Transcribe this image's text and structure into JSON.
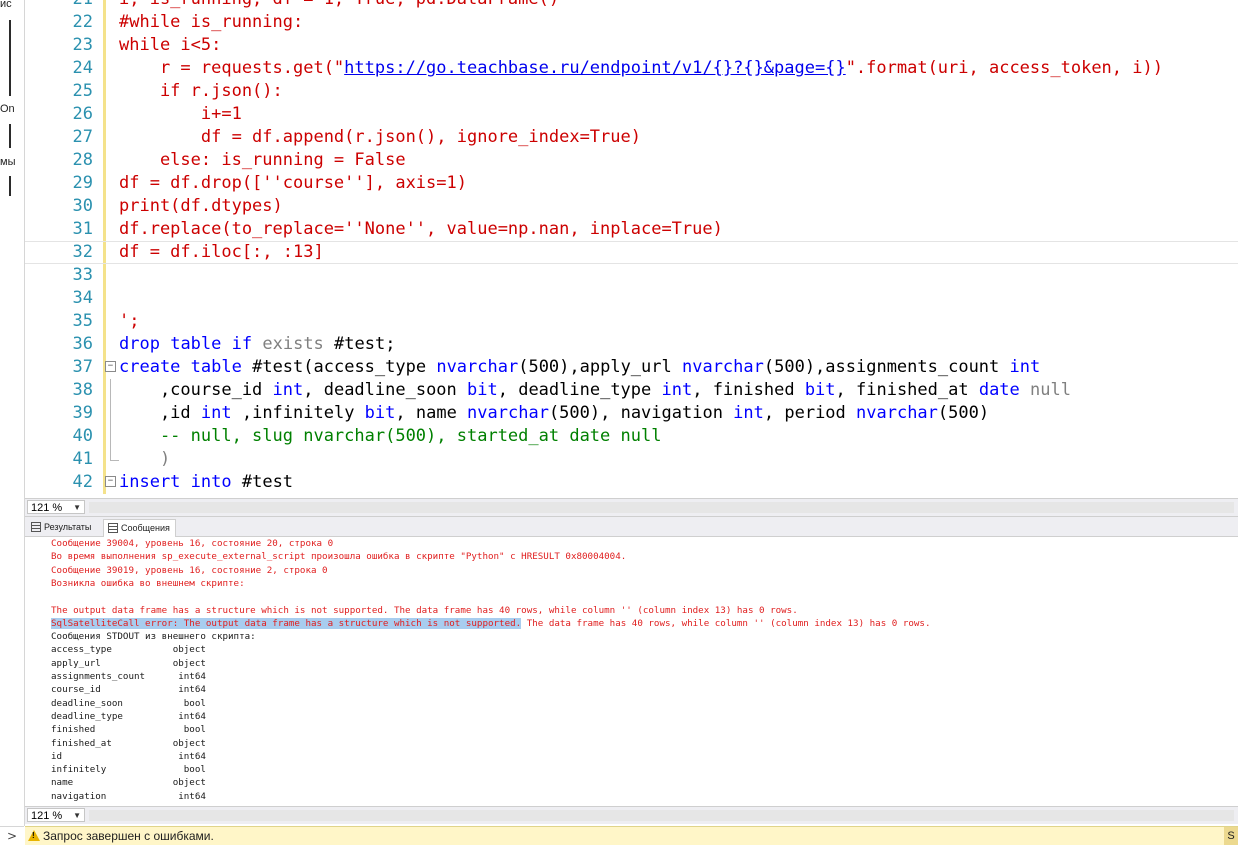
{
  "left_panel": {
    "fragments": [
      "ис",
      "On",
      "мы"
    ]
  },
  "editor": {
    "lines": [
      {
        "num": "21",
        "segments": [
          {
            "t": "i, is_running, df = 1, True, pd.DataFrame()",
            "c": "str"
          }
        ]
      },
      {
        "num": "22",
        "segments": [
          {
            "t": "#while is_running:",
            "c": "str"
          }
        ]
      },
      {
        "num": "23",
        "segments": [
          {
            "t": "while i<5:",
            "c": "str"
          }
        ]
      },
      {
        "num": "24",
        "segments": [
          {
            "t": "    r = requests.get(\"",
            "c": "str"
          },
          {
            "t": "https://go.teachbase.ru/endpoint/v1/{}?{}&page={}",
            "c": "link"
          },
          {
            "t": "\".format(uri, access_token, i))",
            "c": "str"
          }
        ]
      },
      {
        "num": "25",
        "segments": [
          {
            "t": "    if r.json():",
            "c": "str"
          }
        ]
      },
      {
        "num": "26",
        "segments": [
          {
            "t": "        i+=1",
            "c": "str"
          }
        ]
      },
      {
        "num": "27",
        "segments": [
          {
            "t": "        df = df.append(r.json(), ignore_index=True)",
            "c": "str"
          }
        ]
      },
      {
        "num": "28",
        "segments": [
          {
            "t": "    else: is_running = False",
            "c": "str"
          }
        ]
      },
      {
        "num": "29",
        "segments": [
          {
            "t": "df = df.drop([''course''], axis=1)",
            "c": "str"
          }
        ]
      },
      {
        "num": "30",
        "segments": [
          {
            "t": "print(df.dtypes)",
            "c": "str"
          }
        ]
      },
      {
        "num": "31",
        "segments": [
          {
            "t": "df.replace(to_replace=''None'', value=np.nan, inplace=True)",
            "c": "str"
          }
        ]
      },
      {
        "num": "32",
        "segments": [
          {
            "t": "df = df.iloc[:, :13]",
            "c": "str"
          }
        ],
        "current": true
      },
      {
        "num": "33",
        "segments": []
      },
      {
        "num": "34",
        "segments": []
      },
      {
        "num": "35",
        "segments": [
          {
            "t": "';",
            "c": "str"
          }
        ]
      },
      {
        "num": "36",
        "segments": [
          {
            "t": "drop",
            "c": "kw"
          },
          {
            "t": " ",
            "c": "def"
          },
          {
            "t": "table",
            "c": "kw"
          },
          {
            "t": " ",
            "c": "def"
          },
          {
            "t": "if",
            "c": "kw"
          },
          {
            "t": " ",
            "c": "def"
          },
          {
            "t": "exists",
            "c": "gray"
          },
          {
            "t": " #test;",
            "c": "def"
          }
        ]
      },
      {
        "num": "37",
        "segments": [
          {
            "t": "create",
            "c": "kw"
          },
          {
            "t": " ",
            "c": "def"
          },
          {
            "t": "table",
            "c": "kw"
          },
          {
            "t": " #test(access_type ",
            "c": "def"
          },
          {
            "t": "nvarchar",
            "c": "kw"
          },
          {
            "t": "(500),apply_url ",
            "c": "def"
          },
          {
            "t": "nvarchar",
            "c": "kw"
          },
          {
            "t": "(500),assignments_count ",
            "c": "def"
          },
          {
            "t": "int",
            "c": "kw"
          }
        ],
        "fold": "start"
      },
      {
        "num": "38",
        "segments": [
          {
            "t": "    ,course_id ",
            "c": "def"
          },
          {
            "t": "int",
            "c": "kw"
          },
          {
            "t": ", deadline_soon ",
            "c": "def"
          },
          {
            "t": "bit",
            "c": "kw"
          },
          {
            "t": ", deadline_type ",
            "c": "def"
          },
          {
            "t": "int",
            "c": "kw"
          },
          {
            "t": ", finished ",
            "c": "def"
          },
          {
            "t": "bit",
            "c": "kw"
          },
          {
            "t": ", finished_at ",
            "c": "def"
          },
          {
            "t": "date",
            "c": "kw"
          },
          {
            "t": " ",
            "c": "def"
          },
          {
            "t": "null",
            "c": "gray"
          }
        ],
        "fold": "mid"
      },
      {
        "num": "39",
        "segments": [
          {
            "t": "    ,id ",
            "c": "def"
          },
          {
            "t": "int",
            "c": "kw"
          },
          {
            "t": " ,infinitely ",
            "c": "def"
          },
          {
            "t": "bit",
            "c": "kw"
          },
          {
            "t": ", name ",
            "c": "def"
          },
          {
            "t": "nvarchar",
            "c": "kw"
          },
          {
            "t": "(500), navigation ",
            "c": "def"
          },
          {
            "t": "int",
            "c": "kw"
          },
          {
            "t": ", period ",
            "c": "def"
          },
          {
            "t": "nvarchar",
            "c": "kw"
          },
          {
            "t": "(500)",
            "c": "def"
          }
        ],
        "fold": "mid"
      },
      {
        "num": "40",
        "segments": [
          {
            "t": "    -- null, slug nvarchar(500), started_at date null",
            "c": "cmt"
          }
        ],
        "fold": "mid"
      },
      {
        "num": "41",
        "segments": [
          {
            "t": "    )",
            "c": "gray"
          }
        ],
        "fold": "end"
      },
      {
        "num": "42",
        "segments": [
          {
            "t": "insert",
            "c": "kw"
          },
          {
            "t": " ",
            "c": "def"
          },
          {
            "t": "into",
            "c": "kw"
          },
          {
            "t": " #test",
            "c": "def"
          }
        ],
        "fold": "start"
      }
    ]
  },
  "zoom_top": {
    "value": "121 %"
  },
  "zoom_bottom": {
    "value": "121 %"
  },
  "results": {
    "tabs": [
      {
        "label": "Результаты",
        "active": false
      },
      {
        "label": "Сообщения",
        "active": true
      }
    ],
    "messages": [
      {
        "text": "Сообщение 39004, уровень 16, состояние 20, строка 0",
        "kind": "err"
      },
      {
        "text": "Во время выполнения sp_execute_external_script произошла ошибка в скрипте \"Python\" с HRESULT 0x80004004.",
        "kind": "err"
      },
      {
        "text": "Сообщение 39019, уровень 16, состояние 2, строка 0",
        "kind": "err"
      },
      {
        "text": "Возникла ошибка во внешнем скрипте:",
        "kind": "err"
      },
      {
        "text": "",
        "kind": "err"
      },
      {
        "text": "The output data frame has a structure which is not supported. The data frame has 40 rows, while column '' (column index 13) has 0 rows.",
        "kind": "err"
      },
      {
        "text": "SqlSatelliteCall error: The output data frame has a structure which is not supported.",
        "kind": "err",
        "highlight": true,
        "rest": " The data frame has 40 rows, while column '' (column index 13) has 0 rows."
      },
      {
        "text": "Сообщения STDOUT из внешнего скрипта:",
        "kind": "out"
      },
      {
        "text": "access_type           object",
        "kind": "out"
      },
      {
        "text": "apply_url             object",
        "kind": "out"
      },
      {
        "text": "assignments_count      int64",
        "kind": "out"
      },
      {
        "text": "course_id              int64",
        "kind": "out"
      },
      {
        "text": "deadline_soon           bool",
        "kind": "out"
      },
      {
        "text": "deadline_type          int64",
        "kind": "out"
      },
      {
        "text": "finished                bool",
        "kind": "out"
      },
      {
        "text": "finished_at           object",
        "kind": "out"
      },
      {
        "text": "id                     int64",
        "kind": "out"
      },
      {
        "text": "infinitely              bool",
        "kind": "out"
      },
      {
        "text": "name                  object",
        "kind": "out"
      },
      {
        "text": "navigation             int64",
        "kind": "out"
      }
    ]
  },
  "status": {
    "text": "Запрос завершен с ошибками.",
    "right": "S",
    "left_glyph": ">"
  },
  "colors": {
    "string_red": "#cc0000",
    "keyword_blue": "#0000ff",
    "line_number": "#2b91af",
    "error_text": "#e02020",
    "selection": "#a8cdef",
    "status_bg": "#fff6c8"
  }
}
